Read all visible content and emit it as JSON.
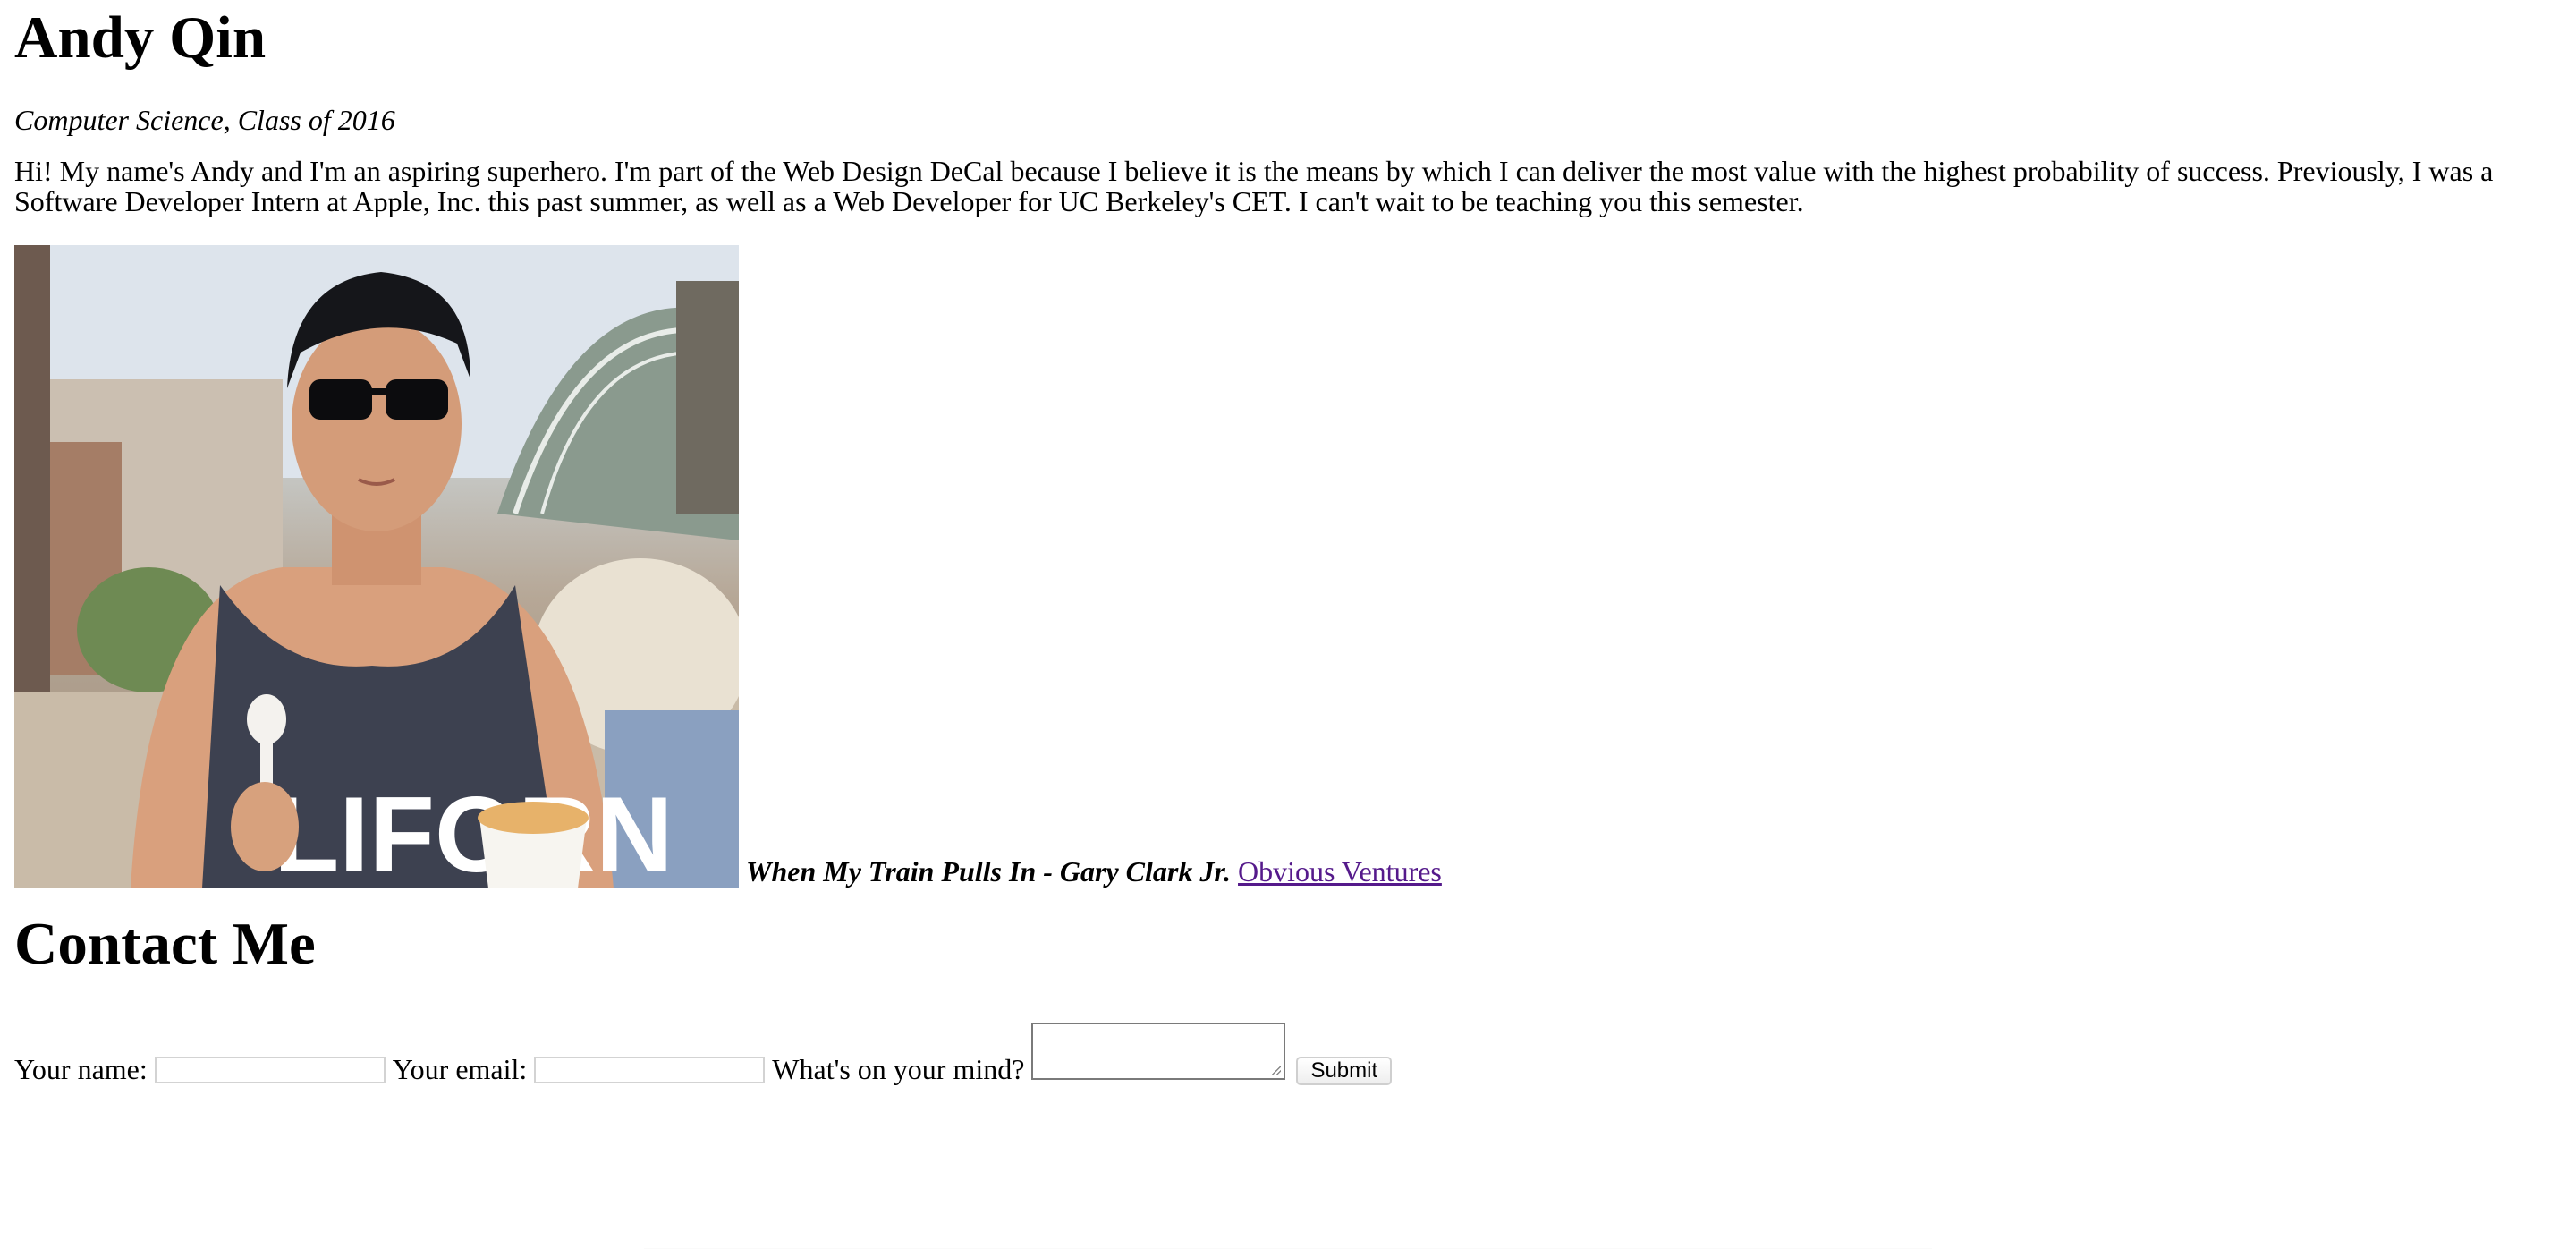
{
  "header": {
    "name": "Andy Qin",
    "subtitle": "Computer Science, Class of 2016",
    "bio": "Hi! My name's Andy and I'm an aspiring superhero. I'm part of the Web Design DeCal because I believe it is the means by which I can deliver the most value with the highest probability of success. Previously, I was a Software Developer Intern at Apple, Inc. this past summer, as well as a Web Developer for UC Berkeley's CET. I can't wait to be teaching you this semester."
  },
  "photo": {
    "shirt_text": "LIFORN"
  },
  "media": {
    "song": "When My Train Pulls In - Gary Clark Jr.",
    "link_label": "Obvious Ventures"
  },
  "contact": {
    "heading": "Contact Me",
    "name_label": "Your name:",
    "email_label": "Your email:",
    "mind_label": "What's on your mind?",
    "submit_label": "Submit"
  }
}
